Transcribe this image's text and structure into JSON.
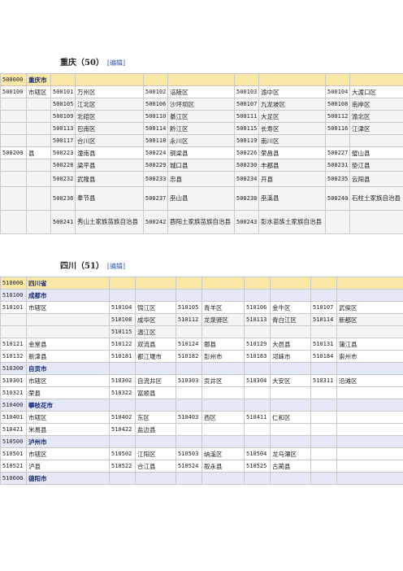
{
  "chongqing": {
    "title": "重庆（50）",
    "edit": "[编辑]",
    "prov_code": "500000",
    "prov_name": "重庆市",
    "rows": [
      [
        "500100",
        "市辖区",
        "500101",
        "万州区",
        "500102",
        "涪陵区",
        "500103",
        "渝中区",
        "500104",
        "大渡口区"
      ],
      [
        "",
        "",
        "500105",
        "江北区",
        "500106",
        "沙坪坝区",
        "500107",
        "九龙坡区",
        "500108",
        "南岸区"
      ],
      [
        "",
        "",
        "500109",
        "北碚区",
        "500110",
        "綦江区",
        "500111",
        "大足区",
        "500112",
        "渝北区"
      ],
      [
        "",
        "",
        "500113",
        "巴南区",
        "500114",
        "黔江区",
        "500115",
        "长寿区",
        "500116",
        "江津区"
      ],
      [
        "",
        "",
        "500117",
        "合川区",
        "500118",
        "永川区",
        "500119",
        "南川区",
        "",
        ""
      ],
      [
        "500200",
        "县",
        "500223",
        "潼南县",
        "500224",
        "铜梁县",
        "500226",
        "荣昌县",
        "500227",
        "璧山县"
      ],
      [
        "",
        "",
        "500228",
        "梁平县",
        "500229",
        "城口县",
        "500230",
        "丰都县",
        "500231",
        "垫江县"
      ],
      [
        "",
        "",
        "500232",
        "武隆县",
        "500233",
        "忠县",
        "500234",
        "开县",
        "500235",
        "云阳县"
      ],
      [
        "",
        "",
        "500236",
        "奉节县",
        "500237",
        "巫山县",
        "500238",
        "巫溪县",
        "500240",
        "石柱土家族自治县"
      ],
      [
        "",
        "",
        "500241",
        "秀山土家族苗族自治县",
        "500242",
        "酉阳土家族苗族自治县",
        "500243",
        "彭水苗族土家族自治县",
        "",
        ""
      ]
    ]
  },
  "sichuan": {
    "title": "四川（51）",
    "edit": "[编辑]",
    "prov_code": "510000",
    "prov_name": "四川省",
    "rows": [
      {
        "kind": "city",
        "cells": [
          "510100",
          "成都市"
        ]
      },
      {
        "kind": "row",
        "cells": [
          "510101",
          "市辖区",
          "510104",
          "锦江区",
          "510105",
          "青羊区",
          "510106",
          "金牛区",
          "510107",
          "武侯区"
        ]
      },
      {
        "kind": "row",
        "cells": [
          "",
          "",
          "510108",
          "成华区",
          "510112",
          "龙泉驿区",
          "510113",
          "青白江区",
          "510114",
          "新都区"
        ]
      },
      {
        "kind": "row",
        "cells": [
          "",
          "",
          "510115",
          "温江区",
          "",
          "",
          "",
          "",
          "",
          ""
        ]
      },
      {
        "kind": "row",
        "cells": [
          "510121",
          "金堂县",
          "510122",
          "双流县",
          "510124",
          "郫县",
          "510129",
          "大邑县",
          "510131",
          "蒲江县"
        ]
      },
      {
        "kind": "row",
        "cells": [
          "510132",
          "新津县",
          "510181",
          "都江堰市",
          "510182",
          "彭州市",
          "510183",
          "邛崃市",
          "510184",
          "崇州市"
        ]
      },
      {
        "kind": "city",
        "cells": [
          "510300",
          "自贡市"
        ]
      },
      {
        "kind": "row",
        "cells": [
          "510301",
          "市辖区",
          "510302",
          "自流井区",
          "510303",
          "贡井区",
          "510304",
          "大安区",
          "510311",
          "沿滩区"
        ]
      },
      {
        "kind": "row",
        "cells": [
          "510321",
          "荣县",
          "510322",
          "富顺县",
          "",
          "",
          "",
          "",
          "",
          ""
        ]
      },
      {
        "kind": "city",
        "cells": [
          "510400",
          "攀枝花市"
        ]
      },
      {
        "kind": "row",
        "cells": [
          "510401",
          "市辖区",
          "510402",
          "东区",
          "510403",
          "西区",
          "510411",
          "仁和区",
          "",
          ""
        ]
      },
      {
        "kind": "row",
        "cells": [
          "510421",
          "米易县",
          "510422",
          "盐边县",
          "",
          "",
          "",
          "",
          "",
          ""
        ]
      },
      {
        "kind": "city",
        "cells": [
          "510500",
          "泸州市"
        ]
      },
      {
        "kind": "row",
        "cells": [
          "510501",
          "市辖区",
          "510502",
          "江阳区",
          "510503",
          "纳溪区",
          "510504",
          "龙马潭区",
          "",
          ""
        ]
      },
      {
        "kind": "row",
        "cells": [
          "510521",
          "泸县",
          "510522",
          "合江县",
          "510524",
          "叙永县",
          "510525",
          "古蔺县",
          "",
          ""
        ]
      },
      {
        "kind": "city",
        "cells": [
          "510600",
          "德阳市"
        ]
      }
    ]
  }
}
